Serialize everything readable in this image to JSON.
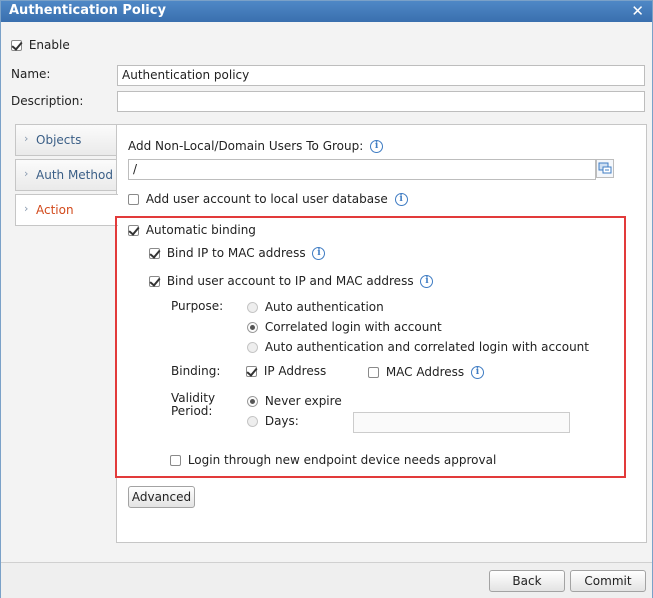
{
  "window": {
    "title": "Authentication Policy",
    "close_glyph": "✕"
  },
  "enable": {
    "label": "Enable",
    "checked": true
  },
  "form": {
    "name_label": "Name:",
    "name_value": "Authentication policy",
    "description_label": "Description:",
    "description_value": ""
  },
  "sidebar": {
    "items": [
      {
        "label": "Objects",
        "active": false
      },
      {
        "label": "Auth Method",
        "active": false
      },
      {
        "label": "Action",
        "active": true
      }
    ]
  },
  "action": {
    "group_label": "Add Non-Local/Domain Users To Group:",
    "group_value": "/",
    "add_local_label": "Add user account to local user database",
    "add_local_checked": false,
    "automatic_binding_label": "Automatic binding",
    "automatic_binding_checked": true,
    "bind_ip_mac_label": "Bind IP to MAC address",
    "bind_ip_mac_checked": true,
    "bind_user_label": "Bind user account to IP and MAC address",
    "bind_user_checked": true,
    "purpose_label": "Purpose:",
    "purpose_options": [
      {
        "label": "Auto authentication",
        "selected": false
      },
      {
        "label": "Correlated login with account",
        "selected": true
      },
      {
        "label": "Auto authentication and correlated login with account",
        "selected": false
      }
    ],
    "binding_label": "Binding:",
    "binding_ip_label": "IP Address",
    "binding_ip_checked": true,
    "binding_mac_label": "MAC Address",
    "binding_mac_checked": false,
    "validity_label_line1": "Validity",
    "validity_label_line2": "Period:",
    "never_expire_label": "Never expire",
    "never_expire_selected": true,
    "days_label": "Days:",
    "days_value": "",
    "login_new_device_label": "Login through new endpoint device needs approval",
    "login_new_device_checked": false,
    "advanced_label": "Advanced"
  },
  "footer": {
    "back_label": "Back",
    "commit_label": "Commit"
  },
  "icons": {
    "info_glyph": "i",
    "chevron_glyph": "›",
    "accent": "#3f7cc3",
    "highlight": "#e23a3a"
  }
}
